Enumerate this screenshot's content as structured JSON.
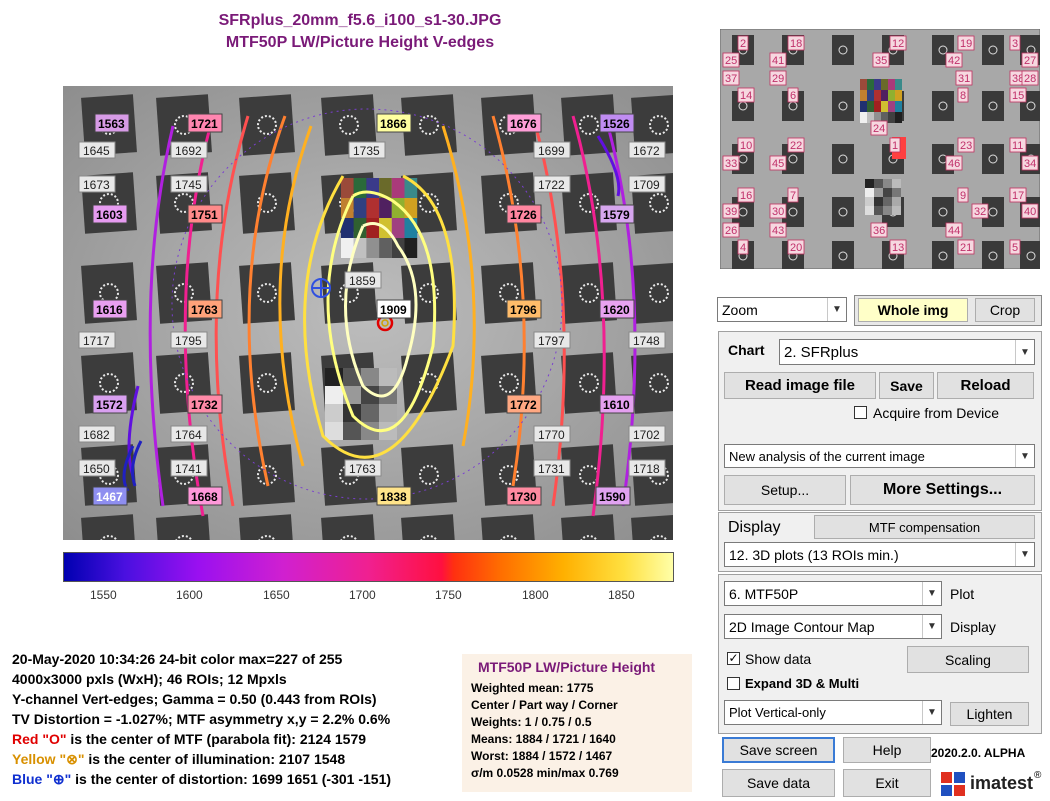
{
  "titles": {
    "filename": "SFRplus_20mm_f5.6_i100_s1-30.JPG",
    "subtitle": "MTF50P LW/Picture Height   V-edges"
  },
  "roi_values": [
    {
      "v": "1563",
      "c": "#d79be6"
    },
    {
      "v": "1721",
      "c": "#ff86b0"
    },
    {
      "v": "1866",
      "c": "#ffffa0"
    },
    {
      "v": "1676",
      "c": "#ff9ed8"
    },
    {
      "v": "1526",
      "c": "#c08cf2"
    },
    {
      "v": "1603",
      "c": "#e69bf0"
    },
    {
      "v": "1751",
      "c": "#ff8a8a"
    },
    {
      "v": "1726",
      "c": "#ff86a0"
    },
    {
      "v": "1579",
      "c": "#d6a6ee"
    },
    {
      "v": "1616",
      "c": "#e89ff0"
    },
    {
      "v": "1763",
      "c": "#ffa27a"
    },
    {
      "v": "1909",
      "c": "#ffffff"
    },
    {
      "v": "1796",
      "c": "#ffbc6a"
    },
    {
      "v": "1620",
      "c": "#e8a2f0"
    },
    {
      "v": "1572",
      "c": "#d9a0f0"
    },
    {
      "v": "1732",
      "c": "#ff8aa8"
    },
    {
      "v": "1772",
      "c": "#ffa882"
    },
    {
      "v": "1610",
      "c": "#e4a0f0"
    },
    {
      "v": "1467",
      "c": "#8e8ef0"
    },
    {
      "v": "1668",
      "c": "#ff98da"
    },
    {
      "v": "1838",
      "c": "#ffe48a"
    },
    {
      "v": "1730",
      "c": "#ff8aa0"
    },
    {
      "v": "1590",
      "c": "#e0a2f0"
    }
  ],
  "grid_values": [
    "1645",
    "1692",
    "1735",
    "1699",
    "1672",
    "1673",
    "1745",
    "1722",
    "1709",
    "1859",
    "1717",
    "1795",
    "1797",
    "1748",
    "1682",
    "1764",
    "1770",
    "1702",
    "1650",
    "1741",
    "1763",
    "1731",
    "1718"
  ],
  "colorbar": {
    "ticks": [
      "1550",
      "1600",
      "1650",
      "1700",
      "1750",
      "1800",
      "1850"
    ]
  },
  "thumb_labels": [
    "2",
    "18",
    "12",
    "19",
    "3",
    "25",
    "41",
    "35",
    "42",
    "27",
    "37",
    "29",
    "31",
    "38",
    "14",
    "6",
    "8",
    "15",
    "24",
    "10",
    "22",
    "23",
    "11",
    "33",
    "45",
    "46",
    "34",
    "16",
    "7",
    "9",
    "17",
    "39",
    "30",
    "32",
    "40",
    "26",
    "43",
    "36",
    "44",
    "5",
    "4",
    "20",
    "13",
    "21",
    "28",
    "1"
  ],
  "info": {
    "line1": "20-May-2020 10:34:26   24-bit color  max=227 of 255",
    "line2": "4000x3000 pxls (WxH);   46 ROIs;  12 Mpxls",
    "line3": "Y-channel   Vert-edges;   Gamma = 0.50  (0.443 from ROIs)",
    "line4": "TV Distortion = -1.027%;  MTF asymmetry x,y = 2.2%  0.6%",
    "red_label": "Red \"O\"",
    "red_text": " is the center of MTF (parabola fit):  2124  1579",
    "yellow_label": "Yellow \"⊗\"",
    "yellow_text": " is the center of illumination:  2107  1548",
    "blue_label": "Blue \"⊕\"",
    "blue_text": " is the center of distortion:  1699  1651  (-301  -151)"
  },
  "stats": {
    "title": "MTF50P LW/Picture Height",
    "weighted_mean": "Weighted mean: 1775",
    "region": "Center / Part way / Corner",
    "weights": "Weights: 1 / 0.75 / 0.5",
    "means": "Means:      1884 / 1721 / 1640",
    "worst": "Worst:      1884 / 1572 / 1467",
    "sigma": "σ/m  0.0528   min/max  0.769"
  },
  "controls": {
    "zoom_select": "Zoom",
    "whole_img": "Whole img",
    "crop": "Crop",
    "chart_label": "Chart",
    "chart_select": "2. SFRplus",
    "read_image": "Read image file",
    "save": "Save",
    "reload": "Reload",
    "acquire": "Acquire from Device",
    "analysis_select": "New analysis of the current image",
    "setup": "Setup...",
    "more_settings": "More Settings...",
    "display_label": "Display",
    "mtf_comp": "MTF compensation",
    "plot3d_select": "12. 3D plots (13 ROIs min.)",
    "metric_select": "6.  MTF50P",
    "plot_label": "Plot",
    "map_select": "2D Image Contour Map",
    "display_label2": "Display",
    "show_data": "Show data",
    "scaling": "Scaling",
    "expand": "Expand 3D & Multi",
    "plot_vertical": "Plot Vertical-only",
    "lighten": "Lighten",
    "save_screen": "Save screen",
    "help": "Help",
    "version": "2020.2.0. ALPHA",
    "save_data": "Save data",
    "exit": "Exit",
    "logo": "imatest",
    "reg": "®"
  }
}
